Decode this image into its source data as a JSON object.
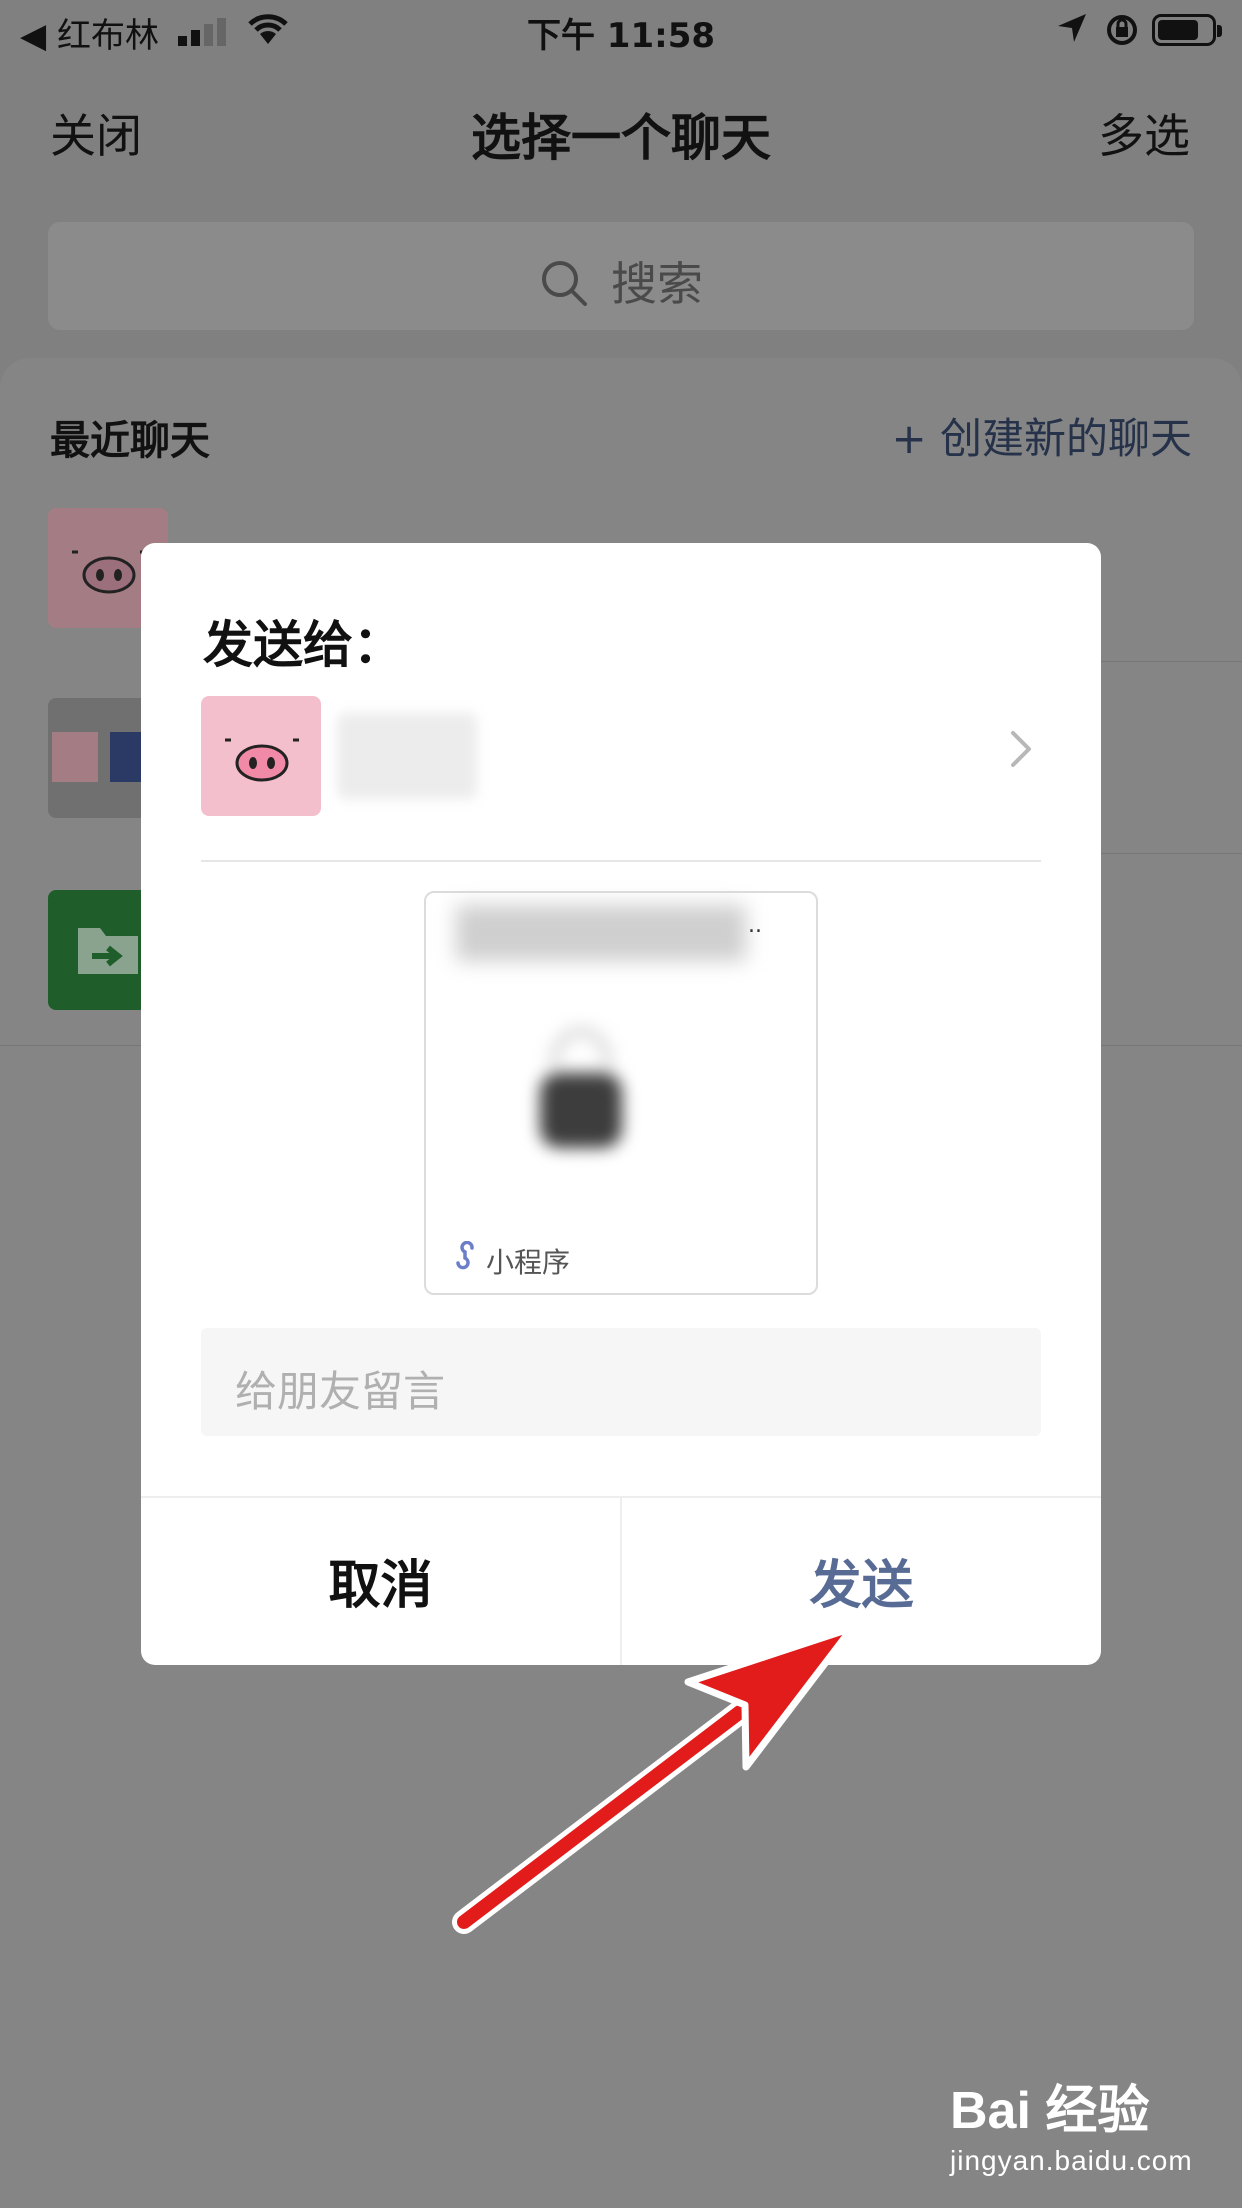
{
  "status_bar": {
    "carrier": "◀ 红布林",
    "time": "下午 11:58"
  },
  "nav": {
    "close_label": "关闭",
    "title": "选择一个聊天",
    "multi_select_label": "多选"
  },
  "search": {
    "placeholder": "搜索"
  },
  "recent": {
    "label": "最近聊天",
    "new_chat_label": "+ 创建新的聊天"
  },
  "dialog": {
    "title": "发送给：",
    "mini_program_tag": "小程序",
    "message_placeholder": "给朋友留言",
    "cancel_label": "取消",
    "send_label": "发送"
  },
  "watermark": {
    "brand": "Bai 经验",
    "url": "jingyan.baidu.com"
  },
  "colors": {
    "send_button": "#576b95",
    "new_chat": "#25324a",
    "pig_avatar": "#f4bfcd",
    "folder_avatar": "#1f7a35",
    "arrow": "#e21b1b"
  }
}
